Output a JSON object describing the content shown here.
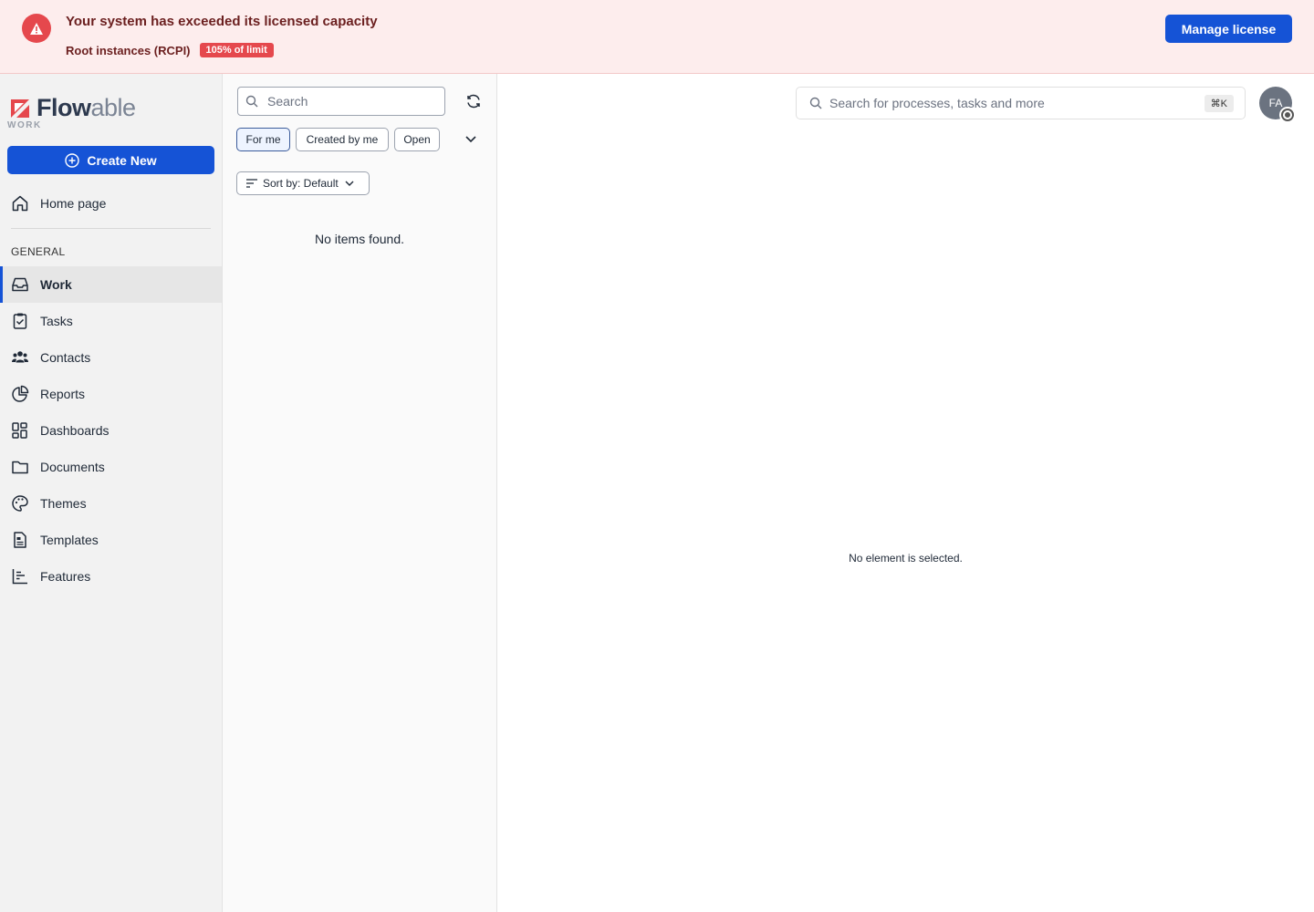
{
  "banner": {
    "title": "Your system has exceeded its licensed capacity",
    "subtitle": "Root instances (RCPI)",
    "badge": "105% of limit",
    "manage_label": "Manage license",
    "icon": "warning-icon"
  },
  "sidebar": {
    "logo_a": "Flow",
    "logo_b": "able",
    "logo_sub": "WORK",
    "create_label": "Create New",
    "home_label": "Home page",
    "section_label": "GENERAL",
    "items": [
      {
        "label": "Work",
        "icon": "inbox-icon",
        "active": true
      },
      {
        "label": "Tasks",
        "icon": "clipboard-check-icon"
      },
      {
        "label": "Contacts",
        "icon": "users-icon"
      },
      {
        "label": "Reports",
        "icon": "pie-chart-icon"
      },
      {
        "label": "Dashboards",
        "icon": "grid-icon"
      },
      {
        "label": "Documents",
        "icon": "folder-icon"
      },
      {
        "label": "Themes",
        "icon": "palette-icon"
      },
      {
        "label": "Templates",
        "icon": "document-icon"
      },
      {
        "label": "Features",
        "icon": "bar-chart-icon"
      }
    ]
  },
  "list": {
    "search_placeholder": "Search",
    "filters": [
      "For me",
      "Created by me",
      "Open"
    ],
    "sort_label": "Sort by: Default",
    "empty": "No items found."
  },
  "main": {
    "search_placeholder": "Search for processes, tasks and more",
    "shortcut": "⌘K",
    "avatar_initials": "FA",
    "empty": "No element is selected."
  },
  "colors": {
    "accent": "#1553d6",
    "danger": "#e5484d",
    "banner_bg": "#fdeded"
  }
}
